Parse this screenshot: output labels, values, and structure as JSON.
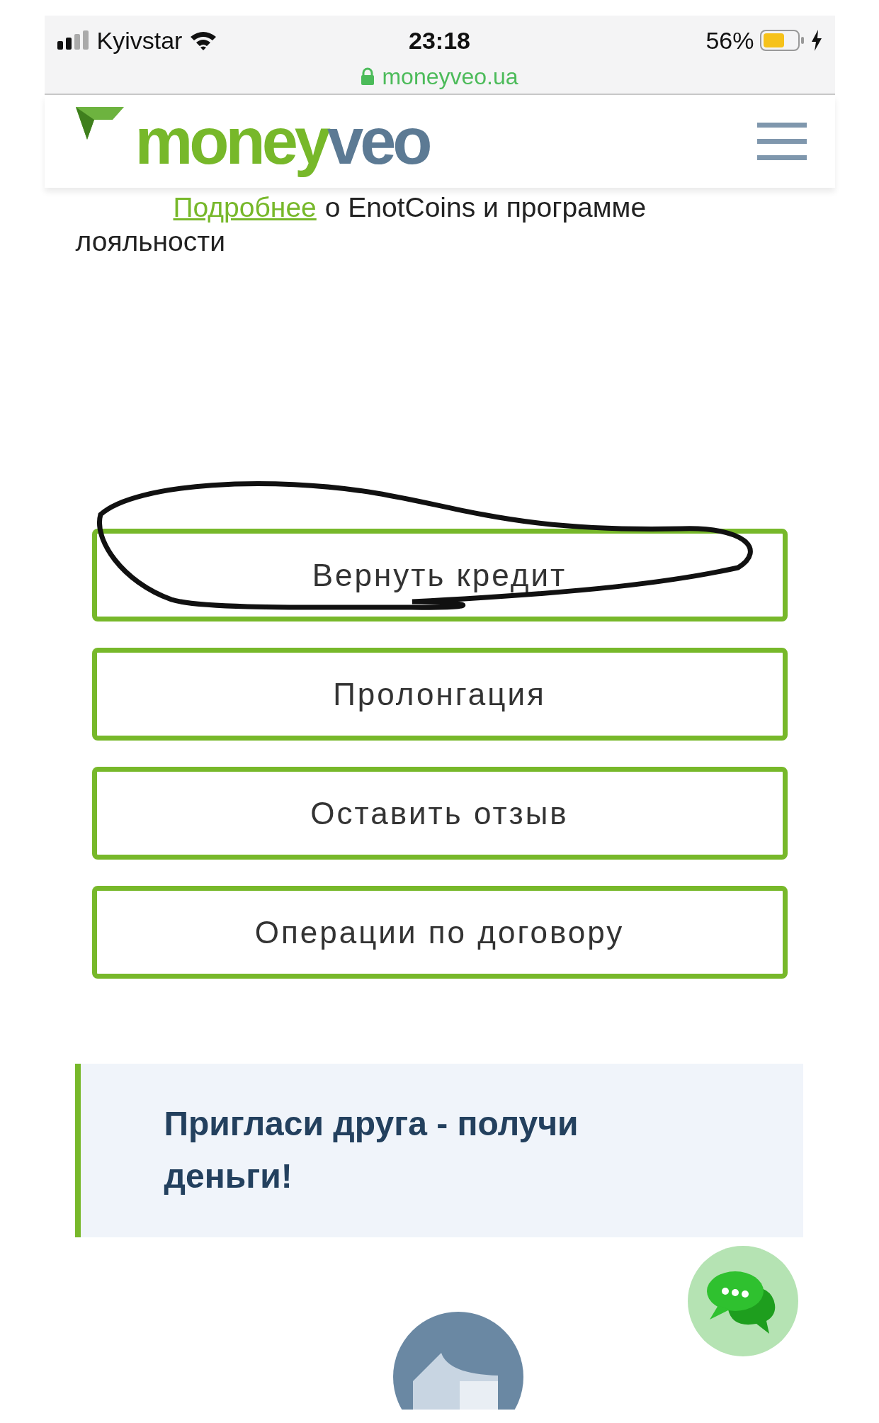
{
  "status_bar": {
    "carrier": "Kyivstar",
    "time": "23:18",
    "battery": "56%",
    "url": "moneyveo.ua"
  },
  "header": {
    "logo_part_1": "money",
    "logo_part_2": "veo"
  },
  "loyalty_note": {
    "link": "Подробнее",
    "text": "о EnotCoins и программе",
    "text_2": "лояльности"
  },
  "buttons": [
    {
      "label": "Вернуть кредит",
      "scribbled": true
    },
    {
      "label": "Пролонгация",
      "scribbled": false
    },
    {
      "label": "Оставить отзыв",
      "scribbled": false
    },
    {
      "label": "Операции по договору",
      "scribbled": false
    }
  ],
  "promo": {
    "title": "Пригласи друга - получи деньги!"
  }
}
